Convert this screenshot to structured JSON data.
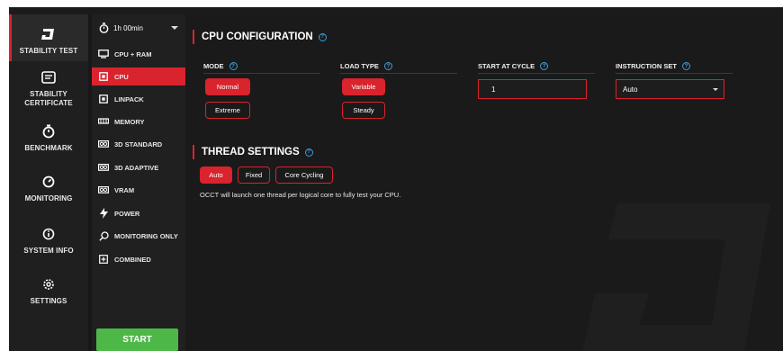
{
  "nav": {
    "items": [
      {
        "label": "STABILITY TEST",
        "icon": "occt-logo-icon"
      },
      {
        "label": "STABILITY CERTIFICATE",
        "icon": "certificate-icon"
      },
      {
        "label": "BENCHMARK",
        "icon": "stopwatch-icon"
      },
      {
        "label": "MONITORING",
        "icon": "gauge-icon"
      },
      {
        "label": "SYSTEM INFO",
        "icon": "info-icon"
      },
      {
        "label": "SETTINGS",
        "icon": "gear-icon"
      }
    ]
  },
  "duration": {
    "value": "1h 00min"
  },
  "tests": {
    "items": [
      {
        "label": "CPU + RAM",
        "icon": "monitor-icon"
      },
      {
        "label": "CPU",
        "icon": "cpu-icon"
      },
      {
        "label": "LINPACK",
        "icon": "cpu-icon"
      },
      {
        "label": "MEMORY",
        "icon": "memory-icon"
      },
      {
        "label": "3D STANDARD",
        "icon": "gpu-icon"
      },
      {
        "label": "3D ADAPTIVE",
        "icon": "gpu-icon"
      },
      {
        "label": "VRAM",
        "icon": "gpu-icon"
      },
      {
        "label": "POWER",
        "icon": "lightning-icon"
      },
      {
        "label": "MONITORING ONLY",
        "icon": "search-icon"
      },
      {
        "label": "COMBINED",
        "icon": "plus-box-icon"
      }
    ],
    "start_label": "START"
  },
  "cpu_config": {
    "title": "CPU CONFIGURATION",
    "mode": {
      "label": "MODE",
      "options": [
        "Normal",
        "Extreme"
      ]
    },
    "load_type": {
      "label": "LOAD TYPE",
      "options": [
        "Variable",
        "Steady"
      ]
    },
    "start_cycle": {
      "label": "START AT CYCLE",
      "value": "1"
    },
    "instruction_set": {
      "label": "INSTRUCTION SET",
      "value": "Auto"
    }
  },
  "thread_settings": {
    "title": "THREAD SETTINGS",
    "options": [
      "Auto",
      "Fixed",
      "Core Cycling"
    ],
    "description": "OCCT will launch one thread per logical core to fully test your CPU."
  },
  "colors": {
    "accent": "#d9232d",
    "start": "#4db848",
    "help": "#3aa0e0"
  }
}
